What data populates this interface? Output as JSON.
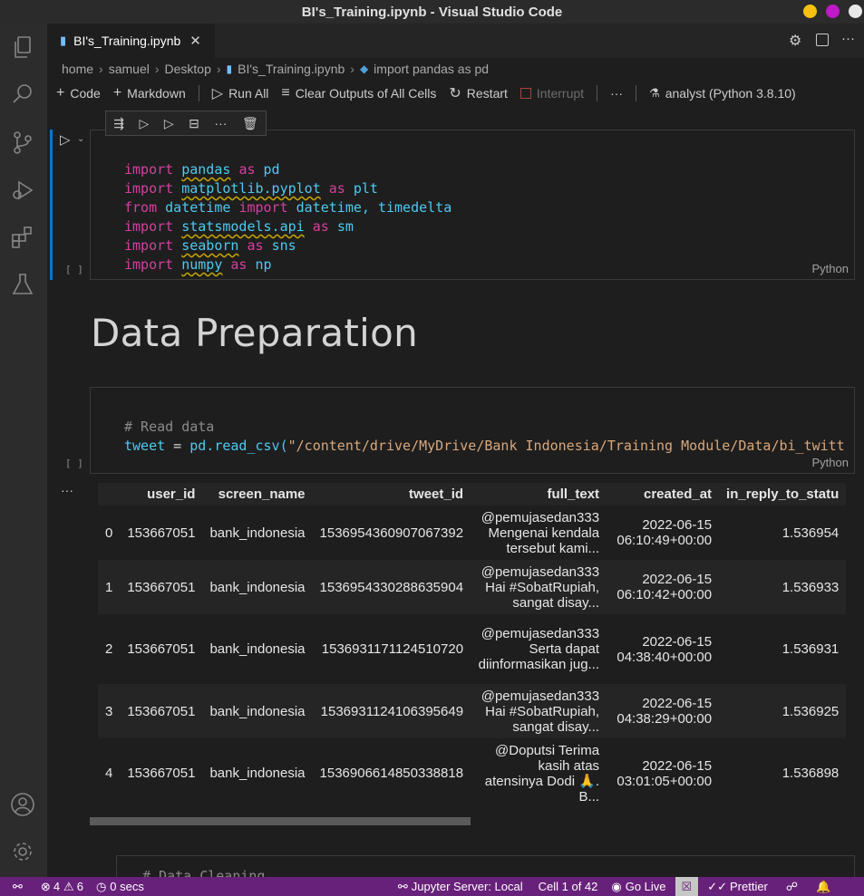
{
  "window": {
    "title": "BI's_Training.ipynb - Visual Studio Code"
  },
  "tab": {
    "label": "BI's_Training.ipynb",
    "close": "✕"
  },
  "breadcrumb": [
    "home",
    "samuel",
    "Desktop",
    "BI's_Training.ipynb",
    "import pandas as pd"
  ],
  "toolbar": {
    "code": "Code",
    "markdown": "Markdown",
    "run_all": "Run All",
    "clear_outputs": "Clear Outputs of All Cells",
    "restart": "Restart",
    "interrupt": "Interrupt",
    "more": "···",
    "kernel": "analyst (Python 3.8.10)"
  },
  "cell1": {
    "exec_count": "[ ]",
    "language": "Python",
    "lines": [
      [
        "import",
        "pandas",
        "as",
        "pd"
      ],
      [
        "import",
        "matplotlib.pyplot",
        "as",
        "plt"
      ],
      [
        "from",
        "datetime",
        "import",
        "datetime, timedelta"
      ],
      [
        "import",
        "statsmodels.api",
        "as",
        "sm"
      ],
      [
        "import",
        "seaborn",
        "as",
        "sns"
      ],
      [
        "import",
        "numpy",
        "as",
        "np"
      ]
    ]
  },
  "markdown": {
    "heading": "Data Preparation"
  },
  "cell2": {
    "exec_count": "[ ]",
    "language": "Python",
    "comment": "# Read data",
    "var": "tweet",
    "eq": " = ",
    "call": "pd.read_csv(",
    "path": "\"/content/drive/MyDrive/Bank Indonesia/Training Module/Data/bi_twitt"
  },
  "output": {
    "ellipsis": "···",
    "columns": [
      "",
      "user_id",
      "screen_name",
      "tweet_id",
      "full_text",
      "created_at",
      "in_reply_to_statu"
    ],
    "rows": [
      [
        "0",
        "153667051",
        "bank_indonesia",
        "1536954360907067392",
        "@pemujasedan333 Mengenai kendala tersebut kami...",
        "2022-06-15 06:10:49+00:00",
        "1.536954"
      ],
      [
        "1",
        "153667051",
        "bank_indonesia",
        "1536954330288635904",
        "@pemujasedan333 Hai #SobatRupiah, sangat disay...",
        "2022-06-15 06:10:42+00:00",
        "1.536933"
      ],
      [
        "2",
        "153667051",
        "bank_indonesia",
        "1536931171124510720",
        "@pemujasedan333 Serta dapat diinformasikan jug...",
        "2022-06-15 04:38:40+00:00",
        "1.536931"
      ],
      [
        "3",
        "153667051",
        "bank_indonesia",
        "1536931124106395649",
        "@pemujasedan333 Hai #SobatRupiah, sangat disay...",
        "2022-06-15 04:38:29+00:00",
        "1.536925"
      ],
      [
        "4",
        "153667051",
        "bank_indonesia",
        "1536906614850338818",
        "@Doputsi Terima kasih atas atensinya Dodi 🙏. B...",
        "2022-06-15 03:01:05+00:00",
        "1.536898"
      ]
    ]
  },
  "cell3": {
    "partial_text": "# Data Cleaning"
  },
  "statusbar": {
    "errors": "4",
    "warnings": "6",
    "timer": "0 secs",
    "jupyter": "Jupyter Server: Local",
    "cell": "Cell 1 of 42",
    "golive": "Go Live",
    "prettier": "Prettier"
  },
  "colors": {
    "accent": "#68217a",
    "titlebar": "#2b2b2b",
    "editor": "#1e1e1e"
  }
}
